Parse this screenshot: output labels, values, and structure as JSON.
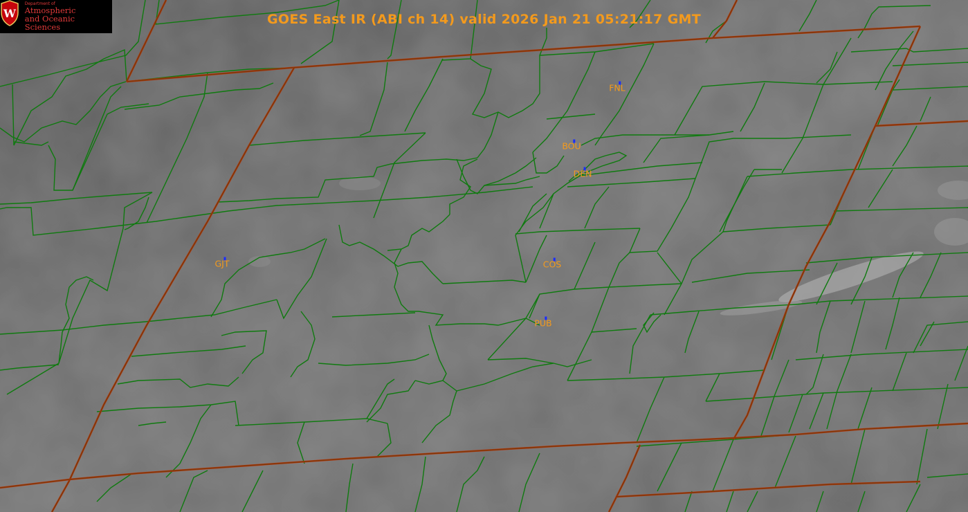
{
  "title": "GOES East IR (ABI ch 14) valid 2026 Jan 21 05:21:17 GMT",
  "logo": {
    "department": "Department of",
    "line1": "Atmospheric",
    "line2": "and Oceanic Sciences"
  },
  "stations": [
    {
      "id": "FNL"
    },
    {
      "id": "BOU"
    },
    {
      "id": "DEN"
    },
    {
      "id": "GJT"
    },
    {
      "id": "COS"
    },
    {
      "id": "PUB"
    }
  ],
  "colors": {
    "title": "#f39a1d",
    "station_label": "#f39a1d",
    "station_marker": "#1a2cff",
    "county_border": "#0f7a0f",
    "state_border": "#7a3a0a",
    "background_ir": "#6e6e6e"
  }
}
